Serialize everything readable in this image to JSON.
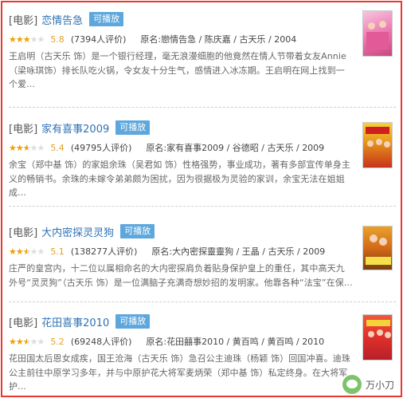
{
  "items": [
    {
      "category": "[电影]",
      "title": "恋情告急",
      "play_label": "可播放",
      "rating": 5.8,
      "score": "5.8",
      "votes": "(7394人评价)",
      "original": "原名:戀情告急 / 陈庆嘉 / 古天乐 / 2004",
      "description": "王启明（古天乐 饰）是一个银行经理，毫无浪漫细胞的他竟然在情人节带着女友Annie（梁咏琪饰）排长队吃火锅，令女友十分生气，感情进入冰冻期。王启明在网上找到一个爱..."
    },
    {
      "category": "[电影]",
      "title": "家有喜事2009",
      "play_label": "可播放",
      "rating": 5.4,
      "score": "5.4",
      "votes": "(49795人评价)",
      "original": "原名:家有喜事2009 / 谷德昭 / 古天乐 / 2009",
      "description": "余宝（郑中基 饰）的家姐余珠（吴君如 饰）性格强势，事业成功，著有多部宣传单身主义的畅销书。余珠的未嫁令弟弟颇为困扰，因为很据极为灵验的家训，余宝无法在姐姐成..."
    },
    {
      "category": "[电影]",
      "title": "大内密探灵灵狗",
      "play_label": "可播放",
      "rating": 5.1,
      "score": "5.1",
      "votes": "(138277人评价)",
      "original": "原名:大內密探靈靈狗 / 王晶 / 古天乐 / 2009",
      "description": "庄严的皇宫内，十二位以属相命名的大内密探肩负着贴身保护皇上的重任，其中高天九外号“灵灵狗”（古天乐 饰）是一位满脑子充满奇想妙招的发明家。他靠各种“法宝”在保..."
    },
    {
      "category": "[电影]",
      "title": "花田喜事2010",
      "play_label": "可播放",
      "rating": 5.2,
      "score": "5.2",
      "votes": "(69248人评价)",
      "original": "原名:花田囍事2010 / 黄百鸣 / 黄百鸣 / 2010",
      "description": "花田国太后恩女成疾，国王沧海（古天乐 饰）急召公主迪珠（杨颖 饰）回国冲喜。迪珠公主前往中原学习多年，并与中原护花大将军麦炳荣（郑中基 饰）私定终身。在大将军护..."
    }
  ],
  "star_glyphs": "★★★★★",
  "watermark": {
    "text": "万小刀",
    "icon": "wechat-icon",
    "color": "#7cc36a"
  },
  "colors": {
    "border": "#e8382f",
    "title_link": "#2f72b6",
    "badge": "#5ea7dc",
    "stars": "#f1a100"
  }
}
